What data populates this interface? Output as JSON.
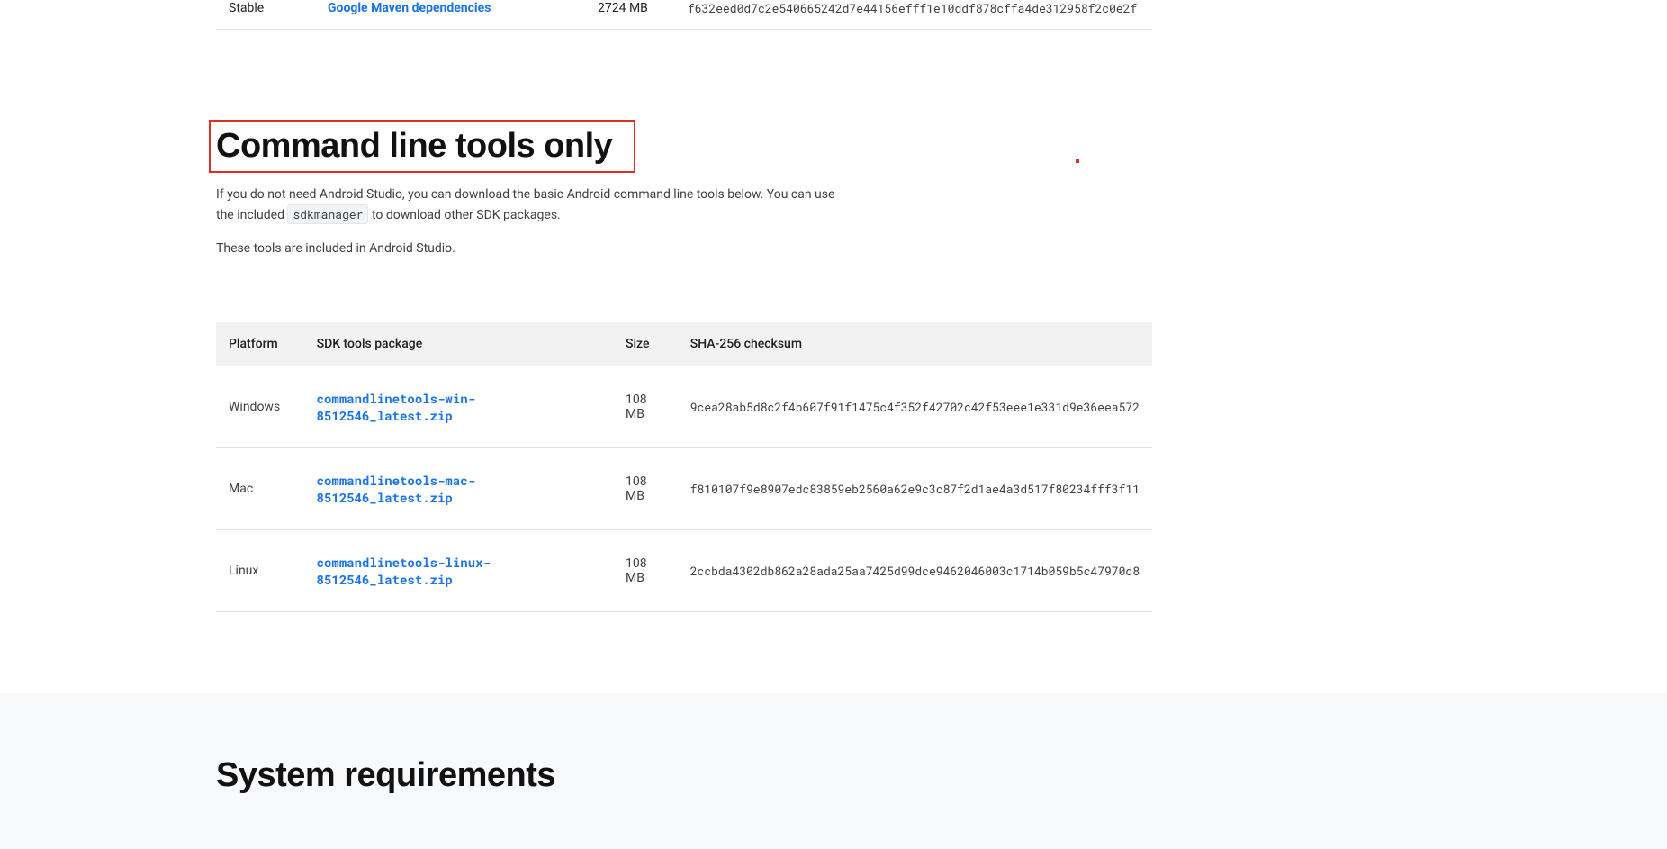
{
  "topRow": {
    "channel": "Stable",
    "packageLabel": "Google Maven dependencies",
    "size": "2724 MB",
    "checksum": "f632eed0d7c2e540665242d7e44156efff1e10ddf878cffa4de312958f2c0e2f"
  },
  "heading": "Command line tools only",
  "intro": {
    "part1": "If you do not need Android Studio, you can download the basic Android command line tools below. You can use the included ",
    "code": "sdkmanager",
    "part2": " to download other SDK packages."
  },
  "intro2": "These tools are included in Android Studio.",
  "table": {
    "headers": {
      "platform": "Platform",
      "package": "SDK tools package",
      "size": "Size",
      "checksum": "SHA-256 checksum"
    },
    "rows": [
      {
        "platform": "Windows",
        "package": "commandlinetools-win-8512546_latest.zip",
        "size": "108 MB",
        "checksum": "9cea28ab5d8c2f4b607f91f1475c4f352f42702c42f53eee1e331d9e36eea572"
      },
      {
        "platform": "Mac",
        "package": "commandlinetools-mac-8512546_latest.zip",
        "size": "108 MB",
        "checksum": "f810107f9e8907edc83859eb2560a62e9c3c87f2d1ae4a3d517f80234fff3f11"
      },
      {
        "platform": "Linux",
        "package": "commandlinetools-linux-8512546_latest.zip",
        "size": "108 MB",
        "checksum": "2ccbda4302db862a28ada25aa7425d99dce9462046003c1714b059b5c47970d8"
      }
    ]
  },
  "sysReqHeading": "System requirements"
}
